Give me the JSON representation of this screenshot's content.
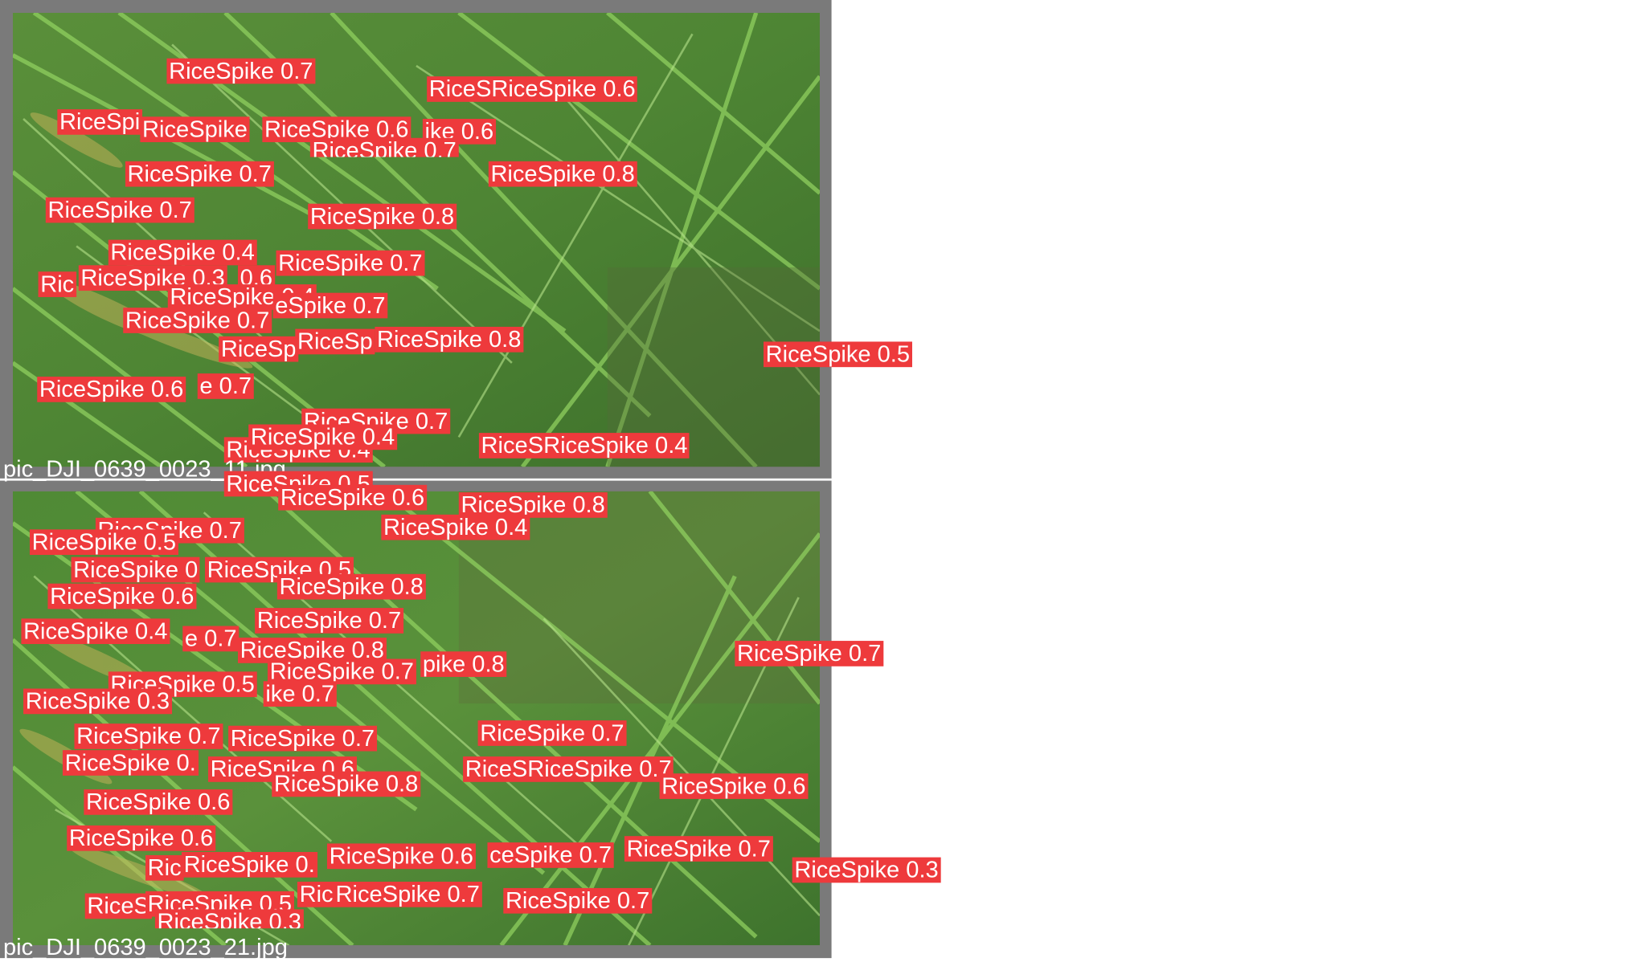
{
  "panels": [
    {
      "caption": "pic_DJI_0639_0023_11.jpg",
      "detections": [
        {
          "label": "RiceSpike 0.7"
        },
        {
          "label": "RiceSRiceSpike 0.6"
        },
        {
          "label": "RiceSpi"
        },
        {
          "label": "RiceSpike"
        },
        {
          "label": "RiceSpike 0.6"
        },
        {
          "label": "ike 0.6"
        },
        {
          "label": "RiceSpike 0.7"
        },
        {
          "label": "RiceSpike 0.7"
        },
        {
          "label": "RiceSpike 0.8"
        },
        {
          "label": "RiceSpike 0.7"
        },
        {
          "label": "RiceSpike 0.8"
        },
        {
          "label": "RiceSpike 0.4"
        },
        {
          "label": "RiceSpike 0.7"
        },
        {
          "label": "Ric"
        },
        {
          "label": "RiceSpike 0.3"
        },
        {
          "label": "0.6"
        },
        {
          "label": "RiceSpike 0.4"
        },
        {
          "label": "eSpike 0.7"
        },
        {
          "label": "RiceSpike 0.7"
        },
        {
          "label": "RiceSp"
        },
        {
          "label": "RiceSp"
        },
        {
          "label": "RiceSpike 0.8"
        },
        {
          "label": "RiceSpike 0.5"
        },
        {
          "label": "RiceSpike 0.6"
        },
        {
          "label": "e 0.7"
        },
        {
          "label": "RiceSpike 0.7"
        },
        {
          "label": "RiceSpike 0.4"
        },
        {
          "label": "RiceSpike 0.4"
        },
        {
          "label": "RiceSRiceSpike 0.4"
        }
      ]
    },
    {
      "caption": "pic_DJI_0639_0023_21.jpg",
      "detections": [
        {
          "label": "RiceSpike 0.5"
        },
        {
          "label": "RiceSpike 0.6"
        },
        {
          "label": "RiceSpike 0.8"
        },
        {
          "label": "RiceSpike 0.7"
        },
        {
          "label": "RiceSpike 0.4"
        },
        {
          "label": "RiceSpike 0.5"
        },
        {
          "label": "RiceSpike 0"
        },
        {
          "label": "RiceSpike 0.5"
        },
        {
          "label": "RiceSpike 0.8"
        },
        {
          "label": "RiceSpike 0.6"
        },
        {
          "label": "RiceSpike 0.7"
        },
        {
          "label": "RiceSpike 0.4"
        },
        {
          "label": "e 0.7"
        },
        {
          "label": "RiceSpike 0.8"
        },
        {
          "label": "pike 0.8"
        },
        {
          "label": "RiceSpike 0.7"
        },
        {
          "label": "RiceSpike 0.7"
        },
        {
          "label": "RiceSpike 0.5"
        },
        {
          "label": "RiceSpike 0.3"
        },
        {
          "label": "ike 0.7"
        },
        {
          "label": "RiceSpike 0.7"
        },
        {
          "label": "RiceSpike 0.7"
        },
        {
          "label": "RiceSpike 0.7"
        },
        {
          "label": "RiceSpike 0."
        },
        {
          "label": "RiceSpike 0.6"
        },
        {
          "label": "RiceSRiceSpike 0.7"
        },
        {
          "label": "RiceSpike 0.8"
        },
        {
          "label": "RiceSpike 0.6"
        },
        {
          "label": "RiceSpike 0.6"
        },
        {
          "label": "RiceSpike 0.6"
        },
        {
          "label": "RiceSpike 0.6"
        },
        {
          "label": "ceSpike 0.7"
        },
        {
          "label": "RiceSpike 0.7"
        },
        {
          "label": "RiceSpike 0.3"
        },
        {
          "label": "Ric"
        },
        {
          "label": "RiceSpike 0."
        },
        {
          "label": "Ric"
        },
        {
          "label": "RiceSpike 0.7"
        },
        {
          "label": "RiceS"
        },
        {
          "label": "RiceSpike 0.5"
        },
        {
          "label": "RiceSpike 0.3"
        },
        {
          "label": "RiceSpike 0.7"
        }
      ]
    }
  ]
}
